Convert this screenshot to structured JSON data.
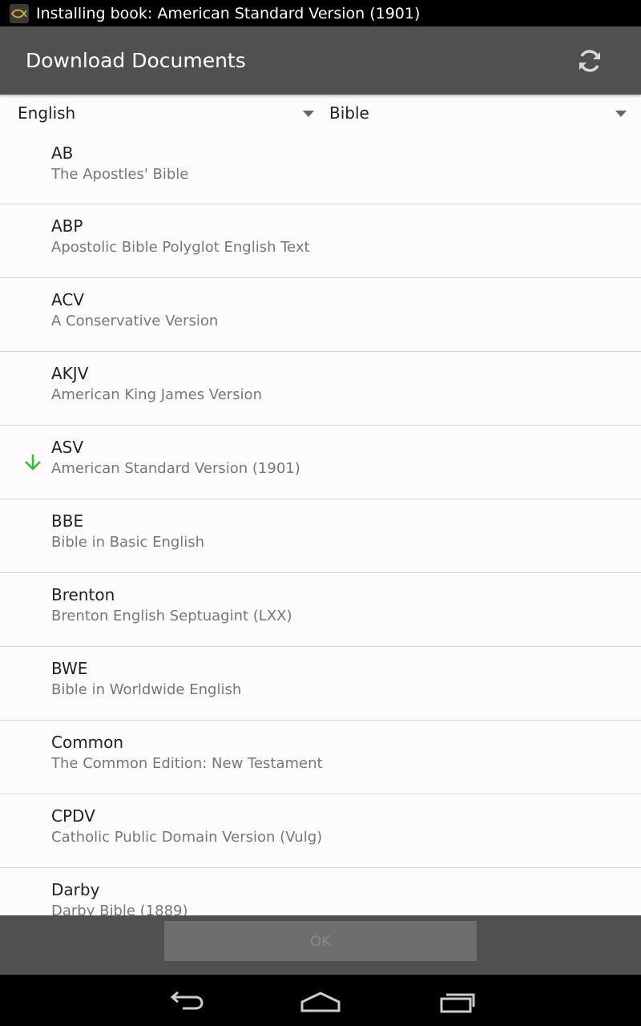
{
  "status_bar": {
    "notification": "Installing book: American Standard Version (1901)",
    "app_icon": "ichthys-fish-icon"
  },
  "action_bar": {
    "title": "Download Documents",
    "refresh_icon": "refresh-icon"
  },
  "filters": {
    "language": "English",
    "document_type": "Bible"
  },
  "documents": [
    {
      "abbr": "AB",
      "name": "The Apostles' Bible",
      "downloading": false
    },
    {
      "abbr": "ABP",
      "name": "Apostolic Bible Polyglot English Text",
      "downloading": false
    },
    {
      "abbr": "ACV",
      "name": "A Conservative Version",
      "downloading": false
    },
    {
      "abbr": "AKJV",
      "name": "American King James Version",
      "downloading": false
    },
    {
      "abbr": "ASV",
      "name": "American Standard Version (1901)",
      "downloading": true
    },
    {
      "abbr": "BBE",
      "name": "Bible in Basic English",
      "downloading": false
    },
    {
      "abbr": "Brenton",
      "name": "Brenton English Septuagint (LXX)",
      "downloading": false
    },
    {
      "abbr": "BWE",
      "name": "Bible in Worldwide English",
      "downloading": false
    },
    {
      "abbr": "Common",
      "name": "The Common Edition: New Testament",
      "downloading": false
    },
    {
      "abbr": "CPDV",
      "name": "Catholic Public Domain Version (Vulg)",
      "downloading": false
    },
    {
      "abbr": "Darby",
      "name": "Darby Bible (1889)",
      "downloading": false
    }
  ],
  "bottom_bar": {
    "ok_label": "OK"
  },
  "navigation": {
    "back_icon": "back-icon",
    "home_icon": "home-icon",
    "recents_icon": "recents-icon"
  },
  "colors": {
    "action_bar": "#505050",
    "download_indicator": "#2ec02e",
    "app_icon_accent": "#e0b020"
  }
}
